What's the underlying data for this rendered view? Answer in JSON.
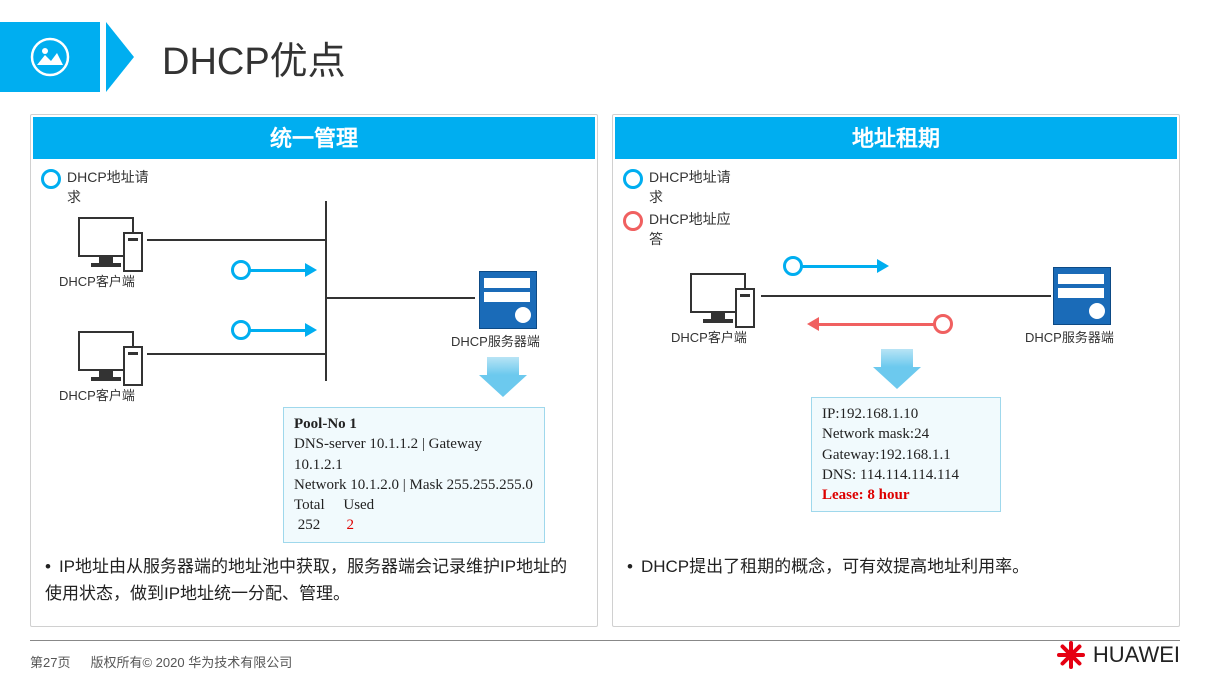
{
  "title": "DHCP优点",
  "leftPanel": {
    "header": "统一管理",
    "legend": {
      "request": "DHCP地址请求"
    },
    "clientLabel": "DHCP客户端",
    "serverLabel": "DHCP服务器端",
    "pool": {
      "title": "Pool-No  1",
      "line1": "DNS-server 10.1.1.2 | Gateway 10.1.2.1",
      "line2": "Network  10.1.2.0   | Mask 255.255.255.0",
      "totalLabel": "Total",
      "usedLabel": "Used",
      "total": "252",
      "used": "2"
    },
    "bullet": "IP地址由从服务器端的地址池中获取，服务器端会记录维护IP地址的使用状态，做到IP地址统一分配、管理。"
  },
  "rightPanel": {
    "header": "地址租期",
    "legend": {
      "request": "DHCP地址请求",
      "reply": "DHCP地址应答"
    },
    "clientLabel": "DHCP客户端",
    "serverLabel": "DHCP服务器端",
    "info": {
      "ip": "IP:192.168.1.10",
      "mask": "Network mask:24",
      "gw": "Gateway:192.168.1.1",
      "dns": "DNS: 114.114.114.114",
      "lease": "Lease: 8 hour"
    },
    "bullet": "DHCP提出了租期的概念，可有效提高地址利用率。"
  },
  "footer": {
    "page": "第27页",
    "copyright": "版权所有© 2020 华为技术有限公司",
    "brand": "HUAWEI"
  }
}
